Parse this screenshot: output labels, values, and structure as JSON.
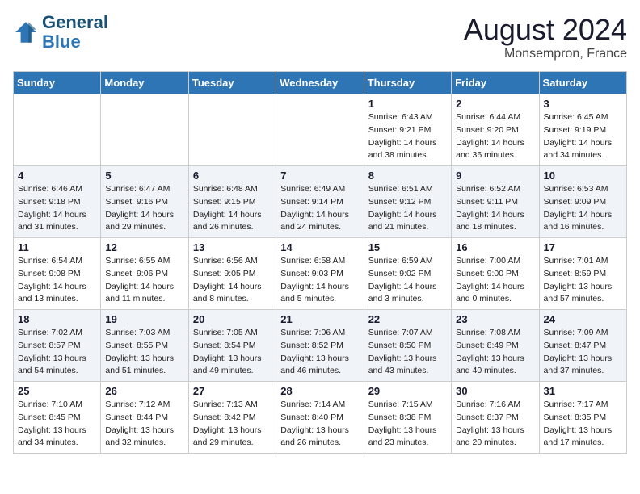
{
  "header": {
    "logo_line1": "General",
    "logo_line2": "Blue",
    "month_year": "August 2024",
    "location": "Monsempron, France"
  },
  "weekdays": [
    "Sunday",
    "Monday",
    "Tuesday",
    "Wednesday",
    "Thursday",
    "Friday",
    "Saturday"
  ],
  "weeks": [
    [
      {
        "day": "",
        "sunrise": "",
        "sunset": "",
        "daylight": ""
      },
      {
        "day": "",
        "sunrise": "",
        "sunset": "",
        "daylight": ""
      },
      {
        "day": "",
        "sunrise": "",
        "sunset": "",
        "daylight": ""
      },
      {
        "day": "",
        "sunrise": "",
        "sunset": "",
        "daylight": ""
      },
      {
        "day": "1",
        "sunrise": "6:43 AM",
        "sunset": "9:21 PM",
        "daylight": "14 hours and 38 minutes."
      },
      {
        "day": "2",
        "sunrise": "6:44 AM",
        "sunset": "9:20 PM",
        "daylight": "14 hours and 36 minutes."
      },
      {
        "day": "3",
        "sunrise": "6:45 AM",
        "sunset": "9:19 PM",
        "daylight": "14 hours and 34 minutes."
      }
    ],
    [
      {
        "day": "4",
        "sunrise": "6:46 AM",
        "sunset": "9:18 PM",
        "daylight": "14 hours and 31 minutes."
      },
      {
        "day": "5",
        "sunrise": "6:47 AM",
        "sunset": "9:16 PM",
        "daylight": "14 hours and 29 minutes."
      },
      {
        "day": "6",
        "sunrise": "6:48 AM",
        "sunset": "9:15 PM",
        "daylight": "14 hours and 26 minutes."
      },
      {
        "day": "7",
        "sunrise": "6:49 AM",
        "sunset": "9:14 PM",
        "daylight": "14 hours and 24 minutes."
      },
      {
        "day": "8",
        "sunrise": "6:51 AM",
        "sunset": "9:12 PM",
        "daylight": "14 hours and 21 minutes."
      },
      {
        "day": "9",
        "sunrise": "6:52 AM",
        "sunset": "9:11 PM",
        "daylight": "14 hours and 18 minutes."
      },
      {
        "day": "10",
        "sunrise": "6:53 AM",
        "sunset": "9:09 PM",
        "daylight": "14 hours and 16 minutes."
      }
    ],
    [
      {
        "day": "11",
        "sunrise": "6:54 AM",
        "sunset": "9:08 PM",
        "daylight": "14 hours and 13 minutes."
      },
      {
        "day": "12",
        "sunrise": "6:55 AM",
        "sunset": "9:06 PM",
        "daylight": "14 hours and 11 minutes."
      },
      {
        "day": "13",
        "sunrise": "6:56 AM",
        "sunset": "9:05 PM",
        "daylight": "14 hours and 8 minutes."
      },
      {
        "day": "14",
        "sunrise": "6:58 AM",
        "sunset": "9:03 PM",
        "daylight": "14 hours and 5 minutes."
      },
      {
        "day": "15",
        "sunrise": "6:59 AM",
        "sunset": "9:02 PM",
        "daylight": "14 hours and 3 minutes."
      },
      {
        "day": "16",
        "sunrise": "7:00 AM",
        "sunset": "9:00 PM",
        "daylight": "14 hours and 0 minutes."
      },
      {
        "day": "17",
        "sunrise": "7:01 AM",
        "sunset": "8:59 PM",
        "daylight": "13 hours and 57 minutes."
      }
    ],
    [
      {
        "day": "18",
        "sunrise": "7:02 AM",
        "sunset": "8:57 PM",
        "daylight": "13 hours and 54 minutes."
      },
      {
        "day": "19",
        "sunrise": "7:03 AM",
        "sunset": "8:55 PM",
        "daylight": "13 hours and 51 minutes."
      },
      {
        "day": "20",
        "sunrise": "7:05 AM",
        "sunset": "8:54 PM",
        "daylight": "13 hours and 49 minutes."
      },
      {
        "day": "21",
        "sunrise": "7:06 AM",
        "sunset": "8:52 PM",
        "daylight": "13 hours and 46 minutes."
      },
      {
        "day": "22",
        "sunrise": "7:07 AM",
        "sunset": "8:50 PM",
        "daylight": "13 hours and 43 minutes."
      },
      {
        "day": "23",
        "sunrise": "7:08 AM",
        "sunset": "8:49 PM",
        "daylight": "13 hours and 40 minutes."
      },
      {
        "day": "24",
        "sunrise": "7:09 AM",
        "sunset": "8:47 PM",
        "daylight": "13 hours and 37 minutes."
      }
    ],
    [
      {
        "day": "25",
        "sunrise": "7:10 AM",
        "sunset": "8:45 PM",
        "daylight": "13 hours and 34 minutes."
      },
      {
        "day": "26",
        "sunrise": "7:12 AM",
        "sunset": "8:44 PM",
        "daylight": "13 hours and 32 minutes."
      },
      {
        "day": "27",
        "sunrise": "7:13 AM",
        "sunset": "8:42 PM",
        "daylight": "13 hours and 29 minutes."
      },
      {
        "day": "28",
        "sunrise": "7:14 AM",
        "sunset": "8:40 PM",
        "daylight": "13 hours and 26 minutes."
      },
      {
        "day": "29",
        "sunrise": "7:15 AM",
        "sunset": "8:38 PM",
        "daylight": "13 hours and 23 minutes."
      },
      {
        "day": "30",
        "sunrise": "7:16 AM",
        "sunset": "8:37 PM",
        "daylight": "13 hours and 20 minutes."
      },
      {
        "day": "31",
        "sunrise": "7:17 AM",
        "sunset": "8:35 PM",
        "daylight": "13 hours and 17 minutes."
      }
    ]
  ],
  "labels": {
    "sunrise_prefix": "Sunrise: ",
    "sunset_prefix": "Sunset: ",
    "daylight_prefix": "Daylight: "
  }
}
